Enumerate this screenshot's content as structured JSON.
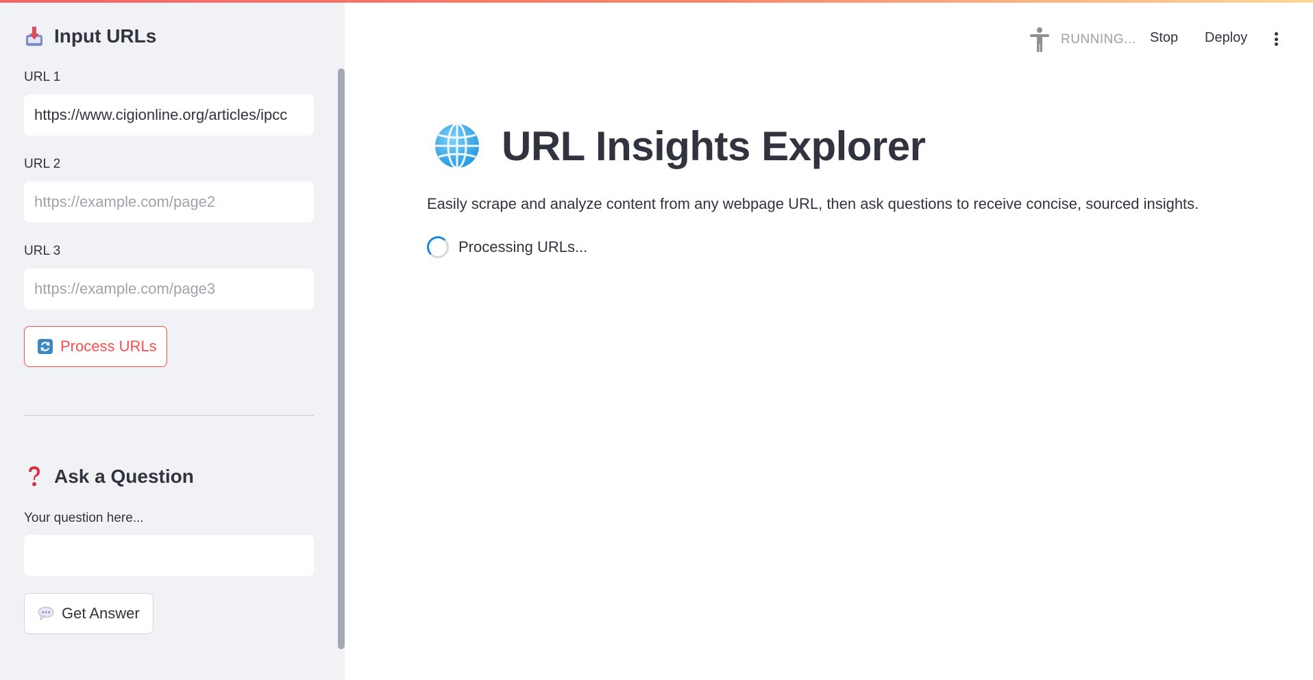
{
  "sidebar": {
    "input_header": "Input URLs",
    "url1": {
      "label": "URL 1",
      "value": "https://www.cigionline.org/articles/ipcc"
    },
    "url2": {
      "label": "URL 2",
      "placeholder": "https://example.com/page2"
    },
    "url3": {
      "label": "URL 3",
      "placeholder": "https://example.com/page3"
    },
    "process_button": "Process URLs",
    "question_header": "Ask a Question",
    "question_label": "Your question here...",
    "question_value": "",
    "answer_button": "Get Answer"
  },
  "header": {
    "status": "RUNNING...",
    "stop": "Stop",
    "deploy": "Deploy"
  },
  "main": {
    "title": "URL Insights Explorer",
    "subtitle": "Easily scrape and analyze content from any webpage URL, then ask questions to receive concise, sourced insights.",
    "processing": "Processing URLs..."
  },
  "icons": {
    "input_header": "inbox-tray-icon",
    "process": "refresh-arrows-icon",
    "question_header": "red-question-mark-icon",
    "answer": "speech-bubble-icon",
    "title": "globe-icon",
    "status": "running-person-icon",
    "menu": "vertical-dots-icon"
  },
  "colors": {
    "accent": "#ff4b4b",
    "sidebar_bg": "#f0f2f6",
    "text": "#31333f",
    "spinner": "#1c83e1"
  }
}
